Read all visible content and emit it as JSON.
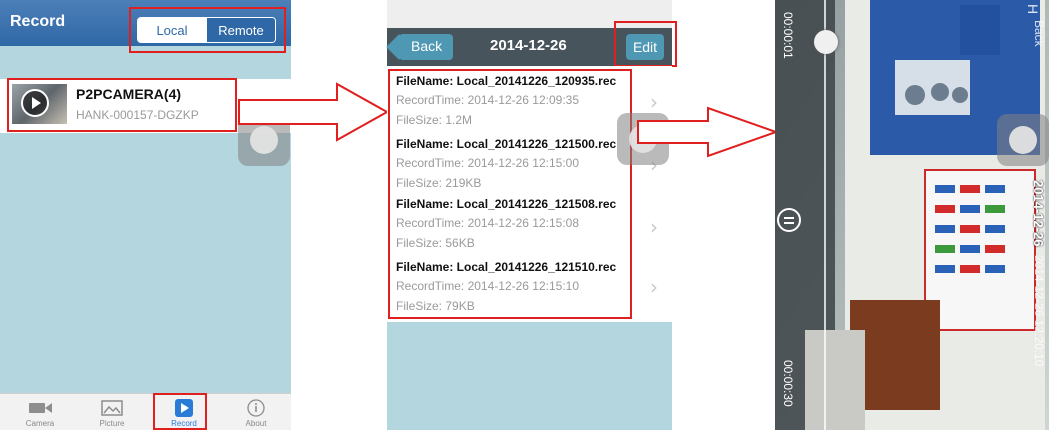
{
  "record_screen": {
    "title": "Record",
    "segments": {
      "local": "Local",
      "remote": "Remote"
    },
    "camera": {
      "name": "P2PCAMERA(4)",
      "uid": "HANK-000157-DGZKP"
    },
    "tabs": [
      {
        "label": "Camera",
        "icon": "video-camera-icon"
      },
      {
        "label": "Picture",
        "icon": "picture-icon"
      },
      {
        "label": "Record",
        "icon": "record-play-icon"
      },
      {
        "label": "About",
        "icon": "info-icon"
      }
    ]
  },
  "file_list_screen": {
    "back_label": "Back",
    "title": "2014-12-26",
    "edit_label": "Edit",
    "files": [
      {
        "name": "FileName: Local_20141226_120935.rec",
        "time": "RecordTime: 2014-12-26 12:09:35",
        "size": "FileSize: 1.2M"
      },
      {
        "name": "FileName: Local_20141226_121500.rec",
        "time": "RecordTime: 2014-12-26 12:15:00",
        "size": "FileSize: 219KB"
      },
      {
        "name": "FileName: Local_20141226_121508.rec",
        "time": "RecordTime: 2014-12-26 12:15:08",
        "size": "FileSize: 56KB"
      },
      {
        "name": "FileName: Local_20141226_121510.rec",
        "time": "RecordTime: 2014-12-26 12:15:10",
        "size": "FileSize: 79KB"
      }
    ]
  },
  "player_screen": {
    "elapsed": "00:00:01",
    "duration": "00:00:30",
    "date_label": "2014-12-26",
    "timestamp_overlay": "2014-12-26  12:20:10",
    "back_label": "Back",
    "hd_label": "H"
  },
  "colors": {
    "annotation_red": "#e01f1f",
    "nav_blue": "#2f68a6",
    "list_bg": "#b4d6df"
  }
}
